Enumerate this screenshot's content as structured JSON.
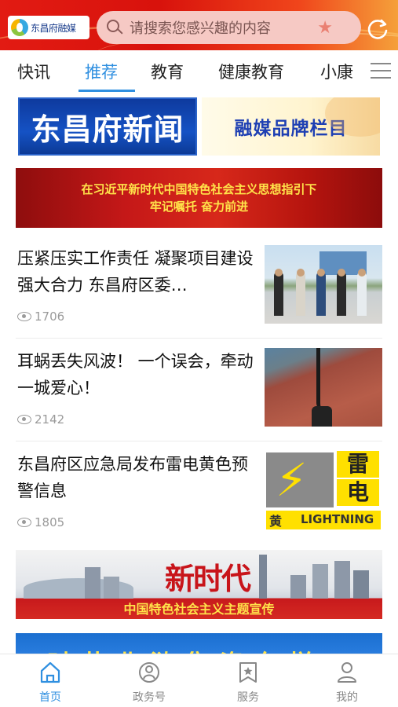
{
  "header": {
    "logo_text": "东昌府融媒",
    "search_placeholder": "请搜索您感兴趣的内容"
  },
  "tabs": [
    {
      "label": "快讯"
    },
    {
      "label": "推荐",
      "active": true
    },
    {
      "label": "教育"
    },
    {
      "label": "健康教育"
    },
    {
      "label": "小康"
    }
  ],
  "banners": {
    "news": "东昌府新闻",
    "brand": "融媒品牌栏目",
    "red_line1": "在习近平新时代中国特色社会主义思想指引下",
    "red_line2": "牢记嘱托 奋力前进",
    "era_big": "新时代",
    "era_sub": "中国特色社会主义主题宣传",
    "partial": "时节北浒集资东样"
  },
  "news": [
    {
      "title": "压紧压实工作责任 凝聚项目建设强大合力 东昌府区委…",
      "views": "1706"
    },
    {
      "title": "耳蜗丢失风波！ 一个误会，牵动一城爱心！",
      "views": "2142"
    },
    {
      "title": "东昌府区应急局发布雷电黄色预警信息",
      "views": "1805"
    }
  ],
  "thumb3": {
    "char1": "雷",
    "char2": "电",
    "char3": "黄",
    "label": "LIGHTNING"
  },
  "bottom_nav": [
    {
      "label": "首页",
      "active": true
    },
    {
      "label": "政务号"
    },
    {
      "label": "服务"
    },
    {
      "label": "我的"
    }
  ],
  "colors": {
    "accent": "#2f8fe0",
    "header_red": "#e21b13"
  }
}
